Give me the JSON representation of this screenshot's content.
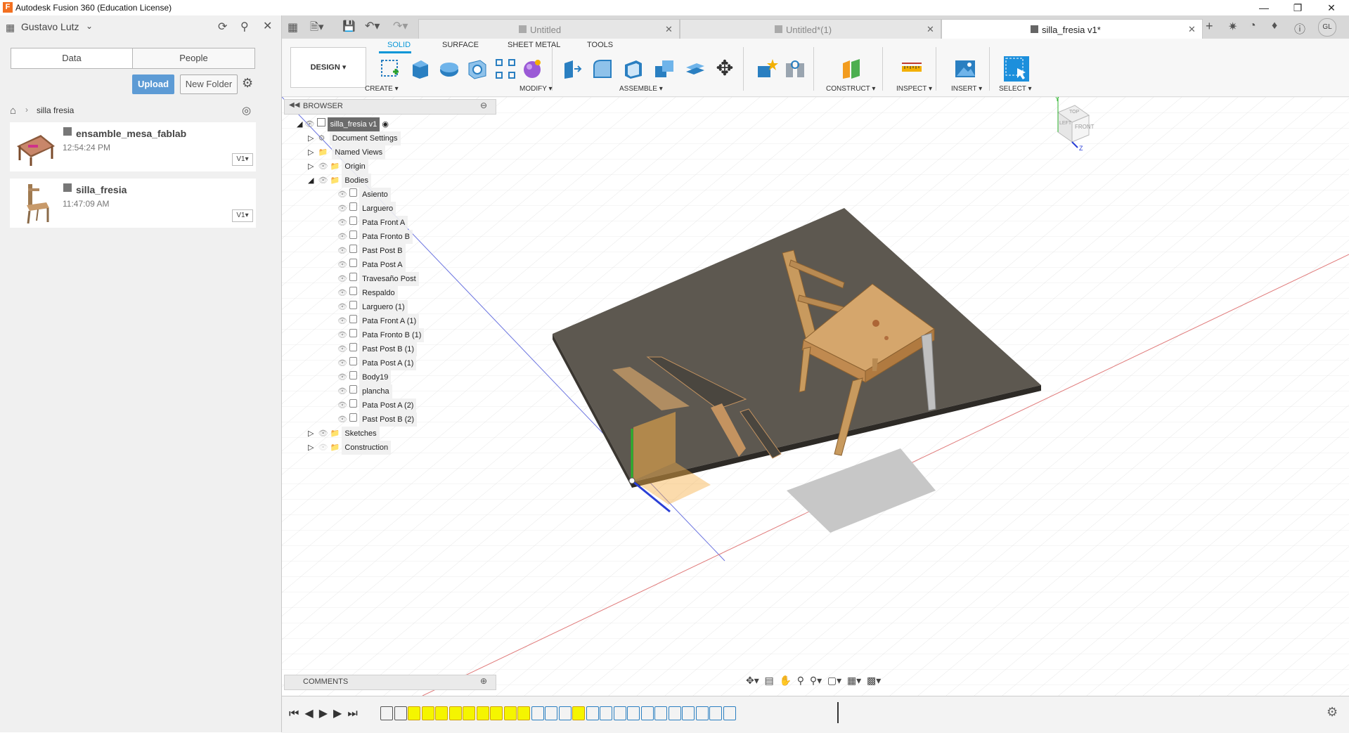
{
  "window": {
    "title": "Autodesk Fusion 360 (Education License)",
    "logo_letter": "F"
  },
  "user": {
    "name": "Gustavo Lutz",
    "initials": "GL"
  },
  "panel": {
    "tabs": [
      "Data",
      "People"
    ],
    "upload_label": "Upload",
    "new_folder_label": "New Folder",
    "breadcrumb": "silla fresia",
    "files": [
      {
        "name": "ensamble_mesa_fablab",
        "time": "12:54:24 PM",
        "version": "V1▾"
      },
      {
        "name": "silla_fresia",
        "time": "11:47:09 AM",
        "version": "V1▾"
      }
    ]
  },
  "doc_tabs": [
    {
      "label": "Untitled",
      "active": false
    },
    {
      "label": "Untitled*(1)",
      "active": false
    },
    {
      "label": "silla_fresia v1*",
      "active": true
    }
  ],
  "toolbar": {
    "workspace": "DESIGN ▾",
    "tabs": [
      "SOLID",
      "SURFACE",
      "SHEET METAL",
      "TOOLS"
    ],
    "active_tab": "SOLID",
    "groups": [
      "CREATE ▾",
      "MODIFY ▾",
      "ASSEMBLE ▾",
      "CONSTRUCT ▾",
      "INSPECT ▾",
      "INSERT ▾",
      "SELECT ▾"
    ]
  },
  "browser": {
    "title": "BROWSER",
    "root": "silla_fresia v1",
    "folders": [
      "Document Settings",
      "Named Views",
      "Origin",
      "Bodies"
    ],
    "bodies": [
      "Asiento",
      "Larguero",
      "Pata Front A",
      "Pata Fronto B",
      "Past Post B",
      "Pata Post A",
      "Travesaño Post",
      "Respaldo",
      "Larguero (1)",
      "Pata Front A (1)",
      "Pata Fronto B (1)",
      "Past Post B (1)",
      "Pata Post A (1)",
      "Body19",
      "plancha",
      "Pata Post A (2)",
      "Past Post B (2)"
    ],
    "after": [
      "Sketches",
      "Construction"
    ]
  },
  "comments_label": "COMMENTS",
  "viewcube": {
    "top": "TOP",
    "front": "FRONT",
    "left": "LEFT",
    "z": "Z",
    "y": "Y"
  },
  "colors": {
    "accent": "#0696d7",
    "upload": "#5d9bd5",
    "select": "#1c8fdc",
    "timeline_hl": "#f5f500"
  }
}
